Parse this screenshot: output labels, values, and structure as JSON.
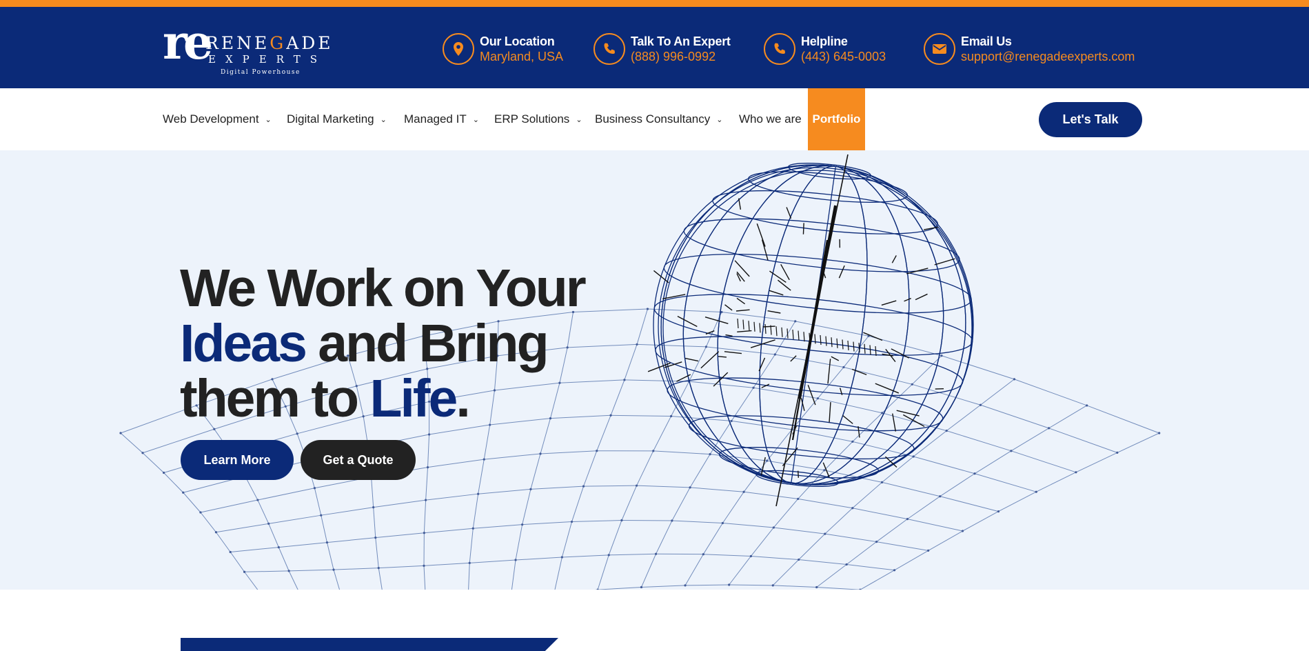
{
  "brand": {
    "logo_mark": "re",
    "logo_word_prefix": "RENE",
    "logo_word_accent": "G",
    "logo_word_suffix": "ADE",
    "logo_word_2": "EXPERTS",
    "tagline": "Digital Powerhouse"
  },
  "contacts": [
    {
      "icon": "location-pin-icon",
      "title": "Our Location",
      "value": "Maryland, USA"
    },
    {
      "icon": "phone-icon",
      "title": "Talk To An Expert",
      "value": "(888) 996-0992"
    },
    {
      "icon": "phone-icon",
      "title": "Helpline",
      "value": "(443) 645-0003"
    },
    {
      "icon": "envelope-icon",
      "title": "Email Us",
      "value": "support@renegadeexperts.com"
    }
  ],
  "nav": {
    "items": [
      {
        "label": "Web Development",
        "dropdown": true
      },
      {
        "label": "Digital Marketing",
        "dropdown": true
      },
      {
        "label": "Managed IT",
        "dropdown": true
      },
      {
        "label": "ERP Solutions",
        "dropdown": true
      },
      {
        "label": "Business Consultancy",
        "dropdown": true
      },
      {
        "label": "Who we are",
        "dropdown": false
      },
      {
        "label": "Portfolio",
        "dropdown": false,
        "active": true
      }
    ],
    "cta": "Let's Talk",
    "chevron_glyph": "⌄"
  },
  "hero": {
    "line1": "We Work on Your",
    "line2_blue": "Ideas",
    "line2_rest": " and Bring",
    "line3_start": "them to ",
    "line3_blue": "Life",
    "line3_end": ".",
    "buttons": {
      "learn_more": "Learn More",
      "get_quote": "Get a Quote"
    }
  },
  "colors": {
    "primary_navy": "#0b2a78",
    "accent_orange": "#f68b1f",
    "dark_text": "#222222",
    "hero_bg": "#edf3fb"
  }
}
